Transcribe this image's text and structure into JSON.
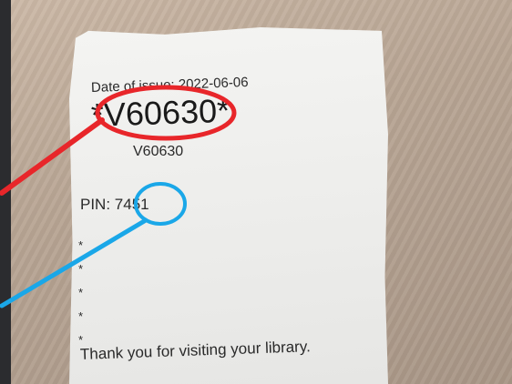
{
  "receipt": {
    "date_label": "Date of issue:",
    "date_value": "2022-06-06",
    "barcode_text": "*V60630*",
    "code": "V60630",
    "pin_label": "PIN:",
    "pin_value": "7451",
    "stars": [
      "*",
      "*",
      "*",
      "*",
      "*"
    ],
    "thanks": "Thank you for visiting your library."
  },
  "annotations": {
    "red_color": "#e8262a",
    "blue_color": "#1aa7e8"
  }
}
